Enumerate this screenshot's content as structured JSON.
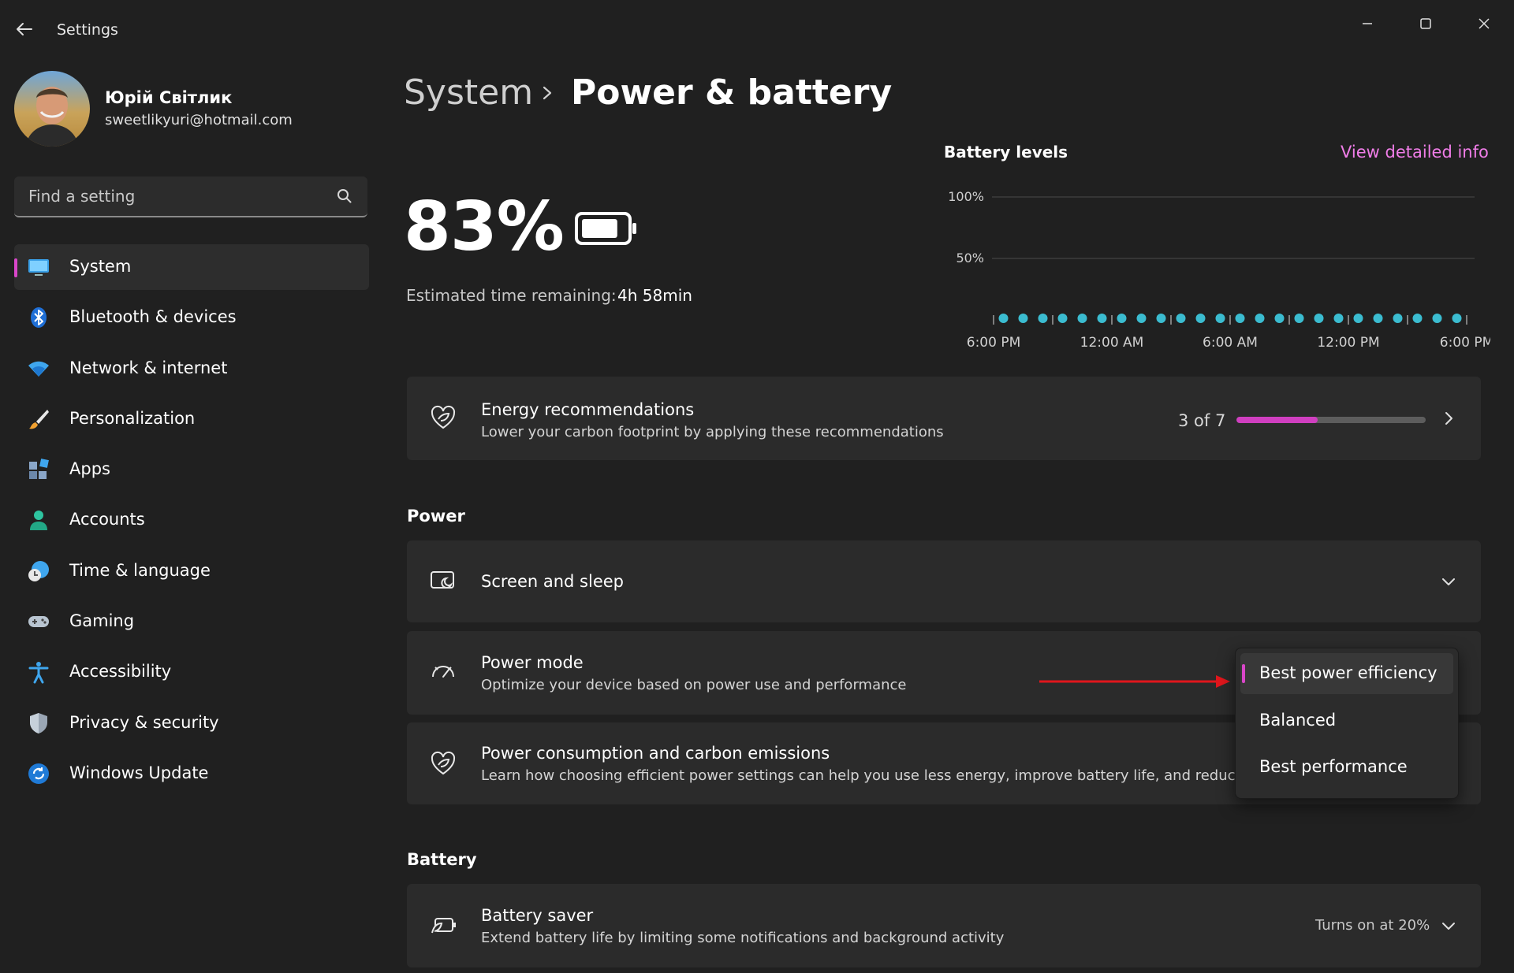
{
  "window": {
    "title": "Settings",
    "back_icon": "back-arrow-icon",
    "controls": [
      "minimize-icon",
      "maximize-icon",
      "close-icon"
    ]
  },
  "profile": {
    "name": "Юрій Світлик",
    "email": "sweetlikyuri@hotmail.com"
  },
  "search": {
    "placeholder": "Find a setting",
    "icon": "search-icon"
  },
  "sidebar": {
    "selected_index": 0,
    "accent": "#d946c9",
    "items": [
      {
        "label": "System",
        "icon": "system-monitor-icon"
      },
      {
        "label": "Bluetooth & devices",
        "icon": "bluetooth-icon"
      },
      {
        "label": "Network & internet",
        "icon": "wifi-icon"
      },
      {
        "label": "Personalization",
        "icon": "paintbrush-icon"
      },
      {
        "label": "Apps",
        "icon": "apps-icon"
      },
      {
        "label": "Accounts",
        "icon": "person-icon"
      },
      {
        "label": "Time & language",
        "icon": "clock-globe-icon"
      },
      {
        "label": "Gaming",
        "icon": "gamepad-icon"
      },
      {
        "label": "Accessibility",
        "icon": "accessibility-icon"
      },
      {
        "label": "Privacy & security",
        "icon": "shield-icon"
      },
      {
        "label": "Windows Update",
        "icon": "update-icon"
      }
    ]
  },
  "header": {
    "breadcrumb_parent": "System",
    "breadcrumb_current": "Power & battery"
  },
  "battery": {
    "percent_text": "83%",
    "level": 0.83,
    "estimate_label": "Estimated time remaining:",
    "estimate_value": "4h 58min"
  },
  "battery_levels": {
    "title": "Battery levels",
    "link": "View detailed info",
    "link_color": "#f07de8"
  },
  "chart_data": {
    "type": "scatter",
    "title": "Battery levels",
    "y_tick_labels": [
      "100%",
      "50%"
    ],
    "y_ticks": [
      100,
      50
    ],
    "x_tick_labels": [
      "6:00 PM",
      "12:00 AM",
      "6:00 AM",
      "12:00 PM",
      "6:00 PM"
    ],
    "x_range_hours": [
      0,
      24
    ],
    "series": [
      {
        "color": "#3bbcd0",
        "x_hours": [
          0.5,
          1.5,
          2.5,
          3.5,
          4.5,
          5.5,
          6.5,
          7.5,
          8.5,
          9.5,
          10.5,
          11.5,
          12.5,
          13.5,
          14.5,
          15.5,
          16.5,
          17.5,
          18.5,
          19.5,
          20.5,
          21.5,
          22.5,
          23.5
        ],
        "values": [
          0,
          0,
          0,
          0,
          0,
          0,
          0,
          0,
          0,
          0,
          0,
          0,
          0,
          0,
          0,
          0,
          0,
          0,
          0,
          0,
          0,
          0,
          0,
          0
        ]
      }
    ],
    "ylim": [
      0,
      100
    ],
    "grid": true
  },
  "energy_recommendations": {
    "title": "Energy recommendations",
    "subtitle": "Lower your carbon footprint by applying these recommendations",
    "count_text": "3 of 7",
    "progress": 0.43,
    "icon": "leaf-heart-icon"
  },
  "power_section": {
    "title": "Power",
    "screen_sleep": {
      "title": "Screen and sleep",
      "icon": "screen-sleep-icon"
    },
    "power_mode": {
      "title": "Power mode",
      "subtitle": "Optimize your device based on power use and performance",
      "icon": "speedometer-icon",
      "options": [
        "Best power efficiency",
        "Balanced",
        "Best performance"
      ],
      "selected_index": 0
    },
    "carbon": {
      "title": "Power consumption and carbon emissions",
      "subtitle": "Learn how choosing efficient power settings can help you use less energy, improve battery life, and reduce car",
      "icon": "leaf-heart-icon"
    }
  },
  "battery_section": {
    "title": "Battery",
    "saver": {
      "title": "Battery saver",
      "subtitle": "Extend battery life by limiting some notifications and background activity",
      "status": "Turns on at 20%",
      "icon": "battery-saver-icon"
    }
  },
  "annotation": {
    "arrow_color": "#e0161c"
  }
}
